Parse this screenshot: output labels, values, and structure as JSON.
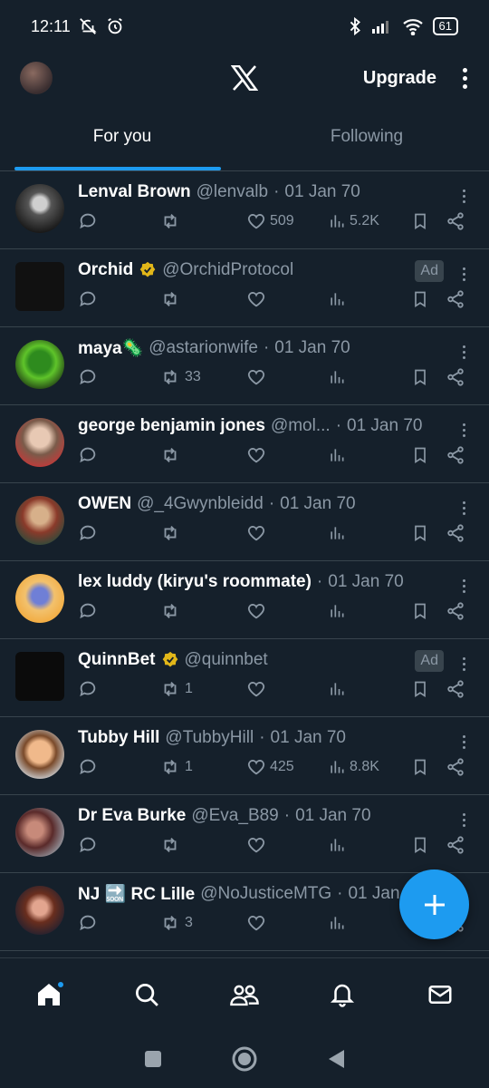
{
  "status": {
    "time": "12:11",
    "battery": "61"
  },
  "header": {
    "upgrade_label": "Upgrade"
  },
  "tabs": [
    {
      "label": "For you"
    },
    {
      "label": "Following"
    }
  ],
  "posts": [
    {
      "name": "Lenval Brown",
      "handle": "@lenvalb",
      "time": "01 Jan 70",
      "replies": "",
      "reposts": "",
      "likes": "509",
      "views": "5.2K",
      "ad": "",
      "verified": false
    },
    {
      "name": "Orchid",
      "handle": "@OrchidProtocol",
      "time": "",
      "replies": "",
      "reposts": "",
      "likes": "",
      "views": "",
      "ad": "Ad",
      "verified": true
    },
    {
      "name": "maya🦠",
      "handle": "@astarionwife",
      "time": "01 Jan 70",
      "replies": "",
      "reposts": "33",
      "likes": "",
      "views": "",
      "ad": "",
      "verified": false
    },
    {
      "name": "george benjamin jones",
      "handle": "@mol...",
      "time": "01 Jan 70",
      "replies": "",
      "reposts": "",
      "likes": "",
      "views": "",
      "ad": "",
      "verified": false
    },
    {
      "name": "OWEN",
      "handle": "@_4Gwynbleidd",
      "time": "01 Jan 70",
      "replies": "",
      "reposts": "",
      "likes": "",
      "views": "",
      "ad": "",
      "verified": false
    },
    {
      "name": "lex luddy (kiryu's roommate)",
      "handle": "",
      "time": "01 Jan 70",
      "replies": "",
      "reposts": "",
      "likes": "",
      "views": "",
      "ad": "",
      "verified": false
    },
    {
      "name": "QuinnBet",
      "handle": "@quinnbet",
      "time": "",
      "replies": "",
      "reposts": "1",
      "likes": "",
      "views": "",
      "ad": "Ad",
      "verified": true
    },
    {
      "name": "Tubby Hill",
      "handle": "@TubbyHill",
      "time": "01 Jan 70",
      "replies": "",
      "reposts": "1",
      "likes": "425",
      "views": "8.8K",
      "ad": "",
      "verified": false
    },
    {
      "name": "Dr Eva Burke",
      "handle": "@Eva_B89",
      "time": "01 Jan 70",
      "replies": "",
      "reposts": "",
      "likes": "",
      "views": "",
      "ad": "",
      "verified": false
    },
    {
      "name": "NJ 🔜 RC Lille",
      "handle": "@NoJusticeMTG",
      "time": "01 Jan",
      "replies": "",
      "reposts": "3",
      "likes": "",
      "views": "",
      "ad": "",
      "verified": false
    }
  ],
  "colors": {
    "accent": "#1d9bf0",
    "background": "#15202b",
    "verified_gold": "#e2b719"
  }
}
